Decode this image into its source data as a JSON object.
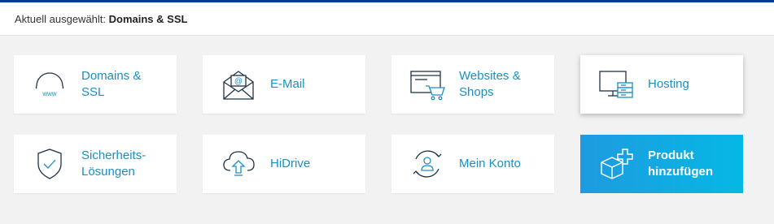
{
  "header": {
    "prefix": "Aktuell ausgewählt:",
    "value": "Domains & SSL"
  },
  "tiles": [
    {
      "label_line1": "Domains &",
      "label_line2": "SSL",
      "icon": "globe-www-icon"
    },
    {
      "label_line1": "E-Mail",
      "label_line2": "",
      "icon": "envelope-at-icon"
    },
    {
      "label_line1": "Websites &",
      "label_line2": "Shops",
      "icon": "browser-cart-icon"
    },
    {
      "label_line1": "Hosting",
      "label_line2": "",
      "icon": "monitor-server-icon"
    },
    {
      "label_line1": "Sicherheits-",
      "label_line2": "Lösungen",
      "icon": "shield-check-icon"
    },
    {
      "label_line1": "HiDrive",
      "label_line2": "",
      "icon": "cloud-upload-icon"
    },
    {
      "label_line1": "Mein Konto",
      "label_line2": "",
      "icon": "user-cycle-icon"
    },
    {
      "label_line1": "Produkt",
      "label_line2": "hinzufügen",
      "icon": "box-plus-icon"
    }
  ],
  "colors": {
    "accent_blue": "#1a8fc4",
    "top_bar": "#003d8f",
    "cta_gradient_start": "#1e9be0",
    "cta_gradient_end": "#05b8e4",
    "icon_dark": "#1f3347"
  }
}
